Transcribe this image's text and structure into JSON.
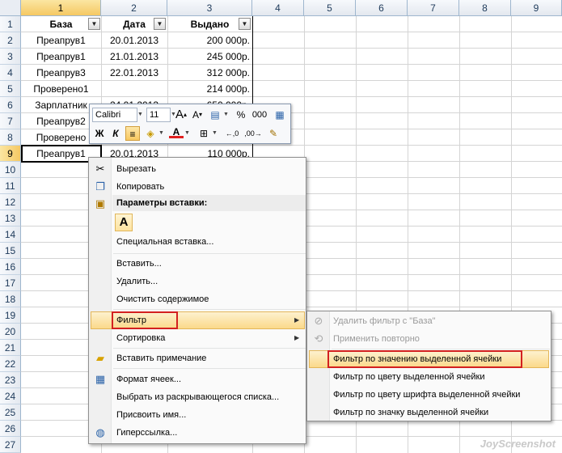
{
  "columns": [
    "1",
    "2",
    "3",
    "4",
    "5",
    "6",
    "7",
    "8",
    "9"
  ],
  "rows": [
    "1",
    "2",
    "3",
    "4",
    "5",
    "6",
    "7",
    "8",
    "9",
    "10",
    "11",
    "12",
    "13",
    "14",
    "15",
    "16",
    "17",
    "18",
    "19",
    "20",
    "21",
    "22",
    "23",
    "24",
    "25",
    "26",
    "27"
  ],
  "table": {
    "headers": [
      "База",
      "Дата",
      "Выдано"
    ],
    "rows": [
      [
        "Преапрув1",
        "20.01.2013",
        "200 000р."
      ],
      [
        "Преапрув1",
        "21.01.2013",
        "245 000р."
      ],
      [
        "Преапрув3",
        "22.01.2013",
        "312 000р."
      ],
      [
        "Проверено1",
        "",
        "214 000р."
      ],
      [
        "Зарплатник",
        "24.01.2013",
        "650 000р."
      ],
      [
        "Преапрув2",
        "",
        "",
        ""
      ],
      [
        "Проверено",
        "",
        "",
        ""
      ],
      [
        "Преапрув1",
        "20.01.2013",
        "110 000р."
      ]
    ]
  },
  "mini_toolbar": {
    "font": "Calibri",
    "size": "11",
    "bold": "Ж",
    "italic": "К",
    "percent": "%",
    "thousands": "000"
  },
  "context_menu": {
    "cut": "Вырезать",
    "copy": "Копировать",
    "paste_options": "Параметры вставки:",
    "paste_glyph": "A",
    "paste_special": "Специальная вставка...",
    "insert": "Вставить...",
    "delete": "Удалить...",
    "clear": "Очистить содержимое",
    "filter": "Фильтр",
    "sort": "Сортировка",
    "insert_comment": "Вставить примечание",
    "format_cells": "Формат ячеек...",
    "pick_list": "Выбрать из раскрывающегося списка...",
    "define_name": "Присвоить имя...",
    "hyperlink": "Гиперссылка..."
  },
  "submenu": {
    "remove_filter": "Удалить фильтр с \"База\"",
    "reapply": "Применить повторно",
    "by_value": "Фильтр по значению выделенной ячейки",
    "by_color": "Фильтр по цвету выделенной ячейки",
    "by_font_color": "Фильтр по цвету шрифта выделенной ячейки",
    "by_icon": "Фильтр по значку выделенной ячейки"
  },
  "watermark": "JoyScreenshot",
  "colors": {
    "highlight": "#fbd98a",
    "red": "#d32020",
    "header_sel": "#f5c863"
  }
}
